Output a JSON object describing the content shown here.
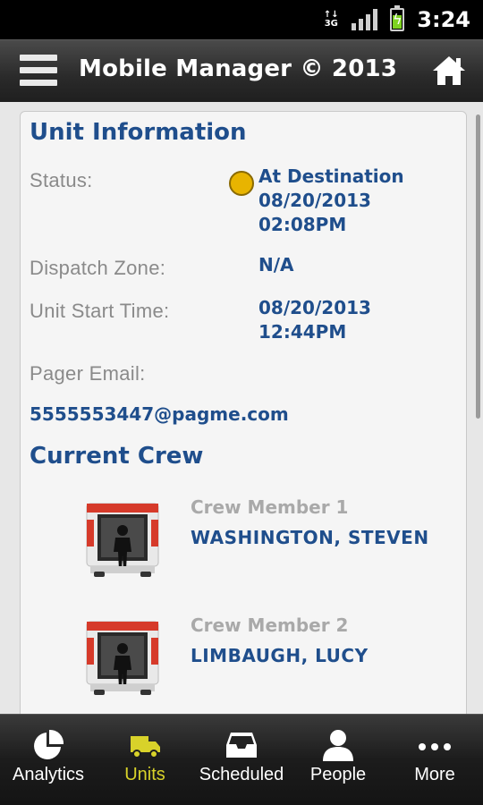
{
  "status_bar": {
    "network": "3G",
    "time": "3:24"
  },
  "header": {
    "title": "Mobile Manager © 2013"
  },
  "unit_information": {
    "title": "Unit Information",
    "status": {
      "label": "Status:",
      "value": "At Destination",
      "date": "08/20/2013",
      "time": "02:08PM",
      "indicator_color": "#e8b400"
    },
    "dispatch_zone": {
      "label": "Dispatch Zone:",
      "value": "N/A"
    },
    "unit_start_time": {
      "label": "Unit Start Time:",
      "date": "08/20/2013",
      "time": "12:44PM"
    },
    "pager_email": {
      "label": "Pager Email:",
      "value": "5555553447@pagme.com"
    }
  },
  "current_crew": {
    "title": "Current Crew",
    "members": [
      {
        "label": "Crew Member 1",
        "name": "WASHINGTON, STEVEN",
        "icon": "ambulance-icon"
      },
      {
        "label": "Crew Member 2",
        "name": "LIMBAUGH, LUCY",
        "icon": "ambulance-icon"
      }
    ]
  },
  "bottom_nav": {
    "items": [
      {
        "label": "Analytics",
        "icon": "pie-chart-icon",
        "active": false
      },
      {
        "label": "Units",
        "icon": "truck-icon",
        "active": true
      },
      {
        "label": "Scheduled",
        "icon": "inbox-icon",
        "active": false
      },
      {
        "label": "People",
        "icon": "person-icon",
        "active": false
      },
      {
        "label": "More",
        "icon": "more-icon",
        "active": false
      }
    ]
  },
  "colors": {
    "accent_blue": "#1f4e8c",
    "active_nav": "#d8d22a"
  }
}
